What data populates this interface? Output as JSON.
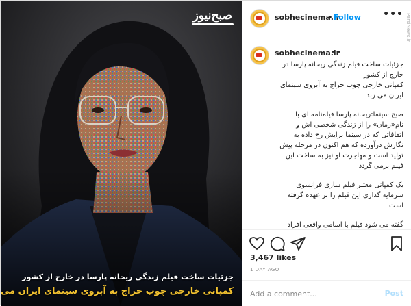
{
  "photo": {
    "watermark": "صبح‌نیوز",
    "caption_line1": "جزئیات ساخت فیلم زندگی ریحانه پارسا در خارج از کشور",
    "caption_line2": "کمپانی خارجی چوب حراج به آبروی سینمای ایران می زند"
  },
  "header": {
    "username": "sobhecinema.ir",
    "separator": "•",
    "follow_label": "Follow",
    "more_icon": "ellipsis-icon",
    "more_label": "•••",
    "side_label": "ParsiNews.ir"
  },
  "caption": {
    "username": "sobhecinema.ir",
    "more_icon": "ellipsis-icon",
    "more_label": "• •",
    "paragraphs": [
      "جزئیات ساخت فیلم زندگی ریحانه پارسا در خارج از کشور",
      "کمپانی خارجی چوب حراج به آبروی سینمای ایران می زند",
      "صبح سینما:ریحانه پارسا فیلمنامه ای با نام«زمان» را از زندگی شخصی اش و اتفاقاتی که در سینما برایش رخ داده به نگارش درآورده که هم اکنون در مرحله پیش تولید است و مهاجرت او نیز به ساخت این فیلم برمی گردد",
      "یک کمپانی معتبر فیلم سازی فرانسوی سرمایه گذاری این فیلم را بر عهده گرفته است",
      "گفته می شود فیلم با اسامی واقعی افراد ساخته خواهد شد و به نوعی افشاگری در مورد ..."
    ]
  },
  "actions": {
    "like_icon": "heart-icon",
    "comment_icon": "comment-icon",
    "share_icon": "share-icon",
    "save_icon": "bookmark-icon"
  },
  "likes": "3,467 likes",
  "time_ago": "1 DAY AGO",
  "comment": {
    "placeholder": "Add a comment...",
    "post_label": "Post"
  }
}
